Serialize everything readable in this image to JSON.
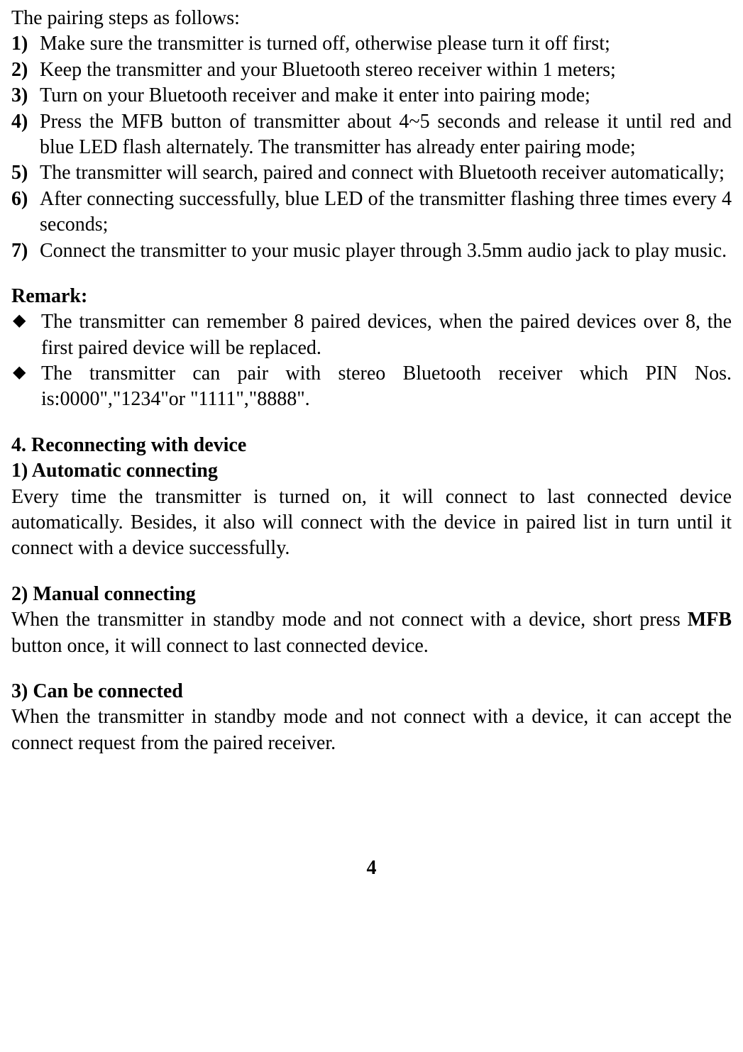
{
  "intro": "The pairing steps as follows:",
  "steps": [
    {
      "num": "1)",
      "text": "Make sure the transmitter is turned off, otherwise please turn it off first;"
    },
    {
      "num": "2)",
      "text": "Keep the transmitter and your Bluetooth stereo receiver within 1 meters;"
    },
    {
      "num": "3)",
      "text": "Turn on your Bluetooth receiver and make it enter into pairing mode;"
    },
    {
      "num": "4)",
      "text": "Press the MFB button of transmitter about 4~5 seconds and release it until red and blue LED flash alternately. The transmitter has already enter pairing mode;"
    },
    {
      "num": "5)",
      "text": "The transmitter will search, paired and connect with Bluetooth receiver automatically;"
    },
    {
      "num": "6)",
      "text": "After connecting successfully, blue LED of the transmitter flashing three times every 4 seconds;"
    },
    {
      "num": "7)",
      "text": "Connect the transmitter to your music player through 3.5mm audio jack to play music."
    }
  ],
  "remark_title": "Remark:",
  "remarks": [
    "The transmitter can remember 8 paired devices, when the paired devices over 8, the first paired device will be replaced.",
    "The transmitter can pair with stereo Bluetooth receiver which PIN Nos. is:0000\",\"1234\"or \"1111\",\"8888\"."
  ],
  "section4": {
    "heading": "4. Reconnecting with device",
    "sub1_title": "1) Automatic connecting",
    "sub1_text": "Every time the transmitter is turned on, it will connect to last connected device automatically. Besides, it also will connect with the device in paired list in turn until it connect with a device successfully.",
    "sub2_title": "2) Manual connecting",
    "sub2_prefix": "When the transmitter in standby mode and not connect with a device, short press ",
    "sub2_mfb": "MFB",
    "sub2_suffix": " button once, it will connect to last connected device.",
    "sub3_title": "3) Can be connected",
    "sub3_text": "When the transmitter in standby mode and not connect with a device, it can accept the connect request from the paired receiver."
  },
  "page_number": "4"
}
